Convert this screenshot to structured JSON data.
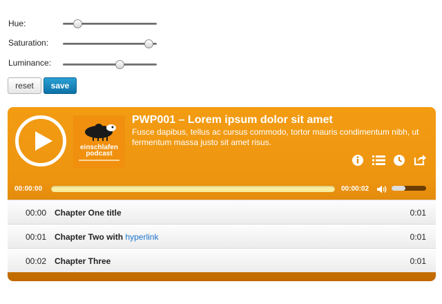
{
  "controls": {
    "hue": {
      "label": "Hue:",
      "value": 0.16
    },
    "saturation": {
      "label": "Saturation:",
      "value": 0.92
    },
    "luminance": {
      "label": "Luminance:",
      "value": 0.61
    },
    "reset_label": "reset",
    "save_label": "save"
  },
  "player": {
    "accent_color": "#f39c12",
    "cover": {
      "line1": "einschlafen",
      "line2": "podcast"
    },
    "episode_title": "PWP001 – Lorem ipsum dolor sit amet",
    "episode_description": "Fusce dapibus, tellus ac cursus commodo, tortor mauris condimentum nibh, ut fermentum massa justo sit amet risus.",
    "buttons": [
      "info-icon",
      "chapters-list-icon",
      "clock-icon",
      "share-icon"
    ],
    "current_time": "00:00:00",
    "duration": "00:00:02",
    "volume": 0.4,
    "chapters": [
      {
        "start": "00:00",
        "title": "Chapter One title",
        "link_text": "",
        "duration": "0:01"
      },
      {
        "start": "00:01",
        "title": "Chapter Two with",
        "link_text": "hyperlink",
        "duration": "0:01"
      },
      {
        "start": "00:02",
        "title": "Chapter Three",
        "link_text": "",
        "duration": "0:01"
      }
    ],
    "link_color": "#1a73c9"
  }
}
